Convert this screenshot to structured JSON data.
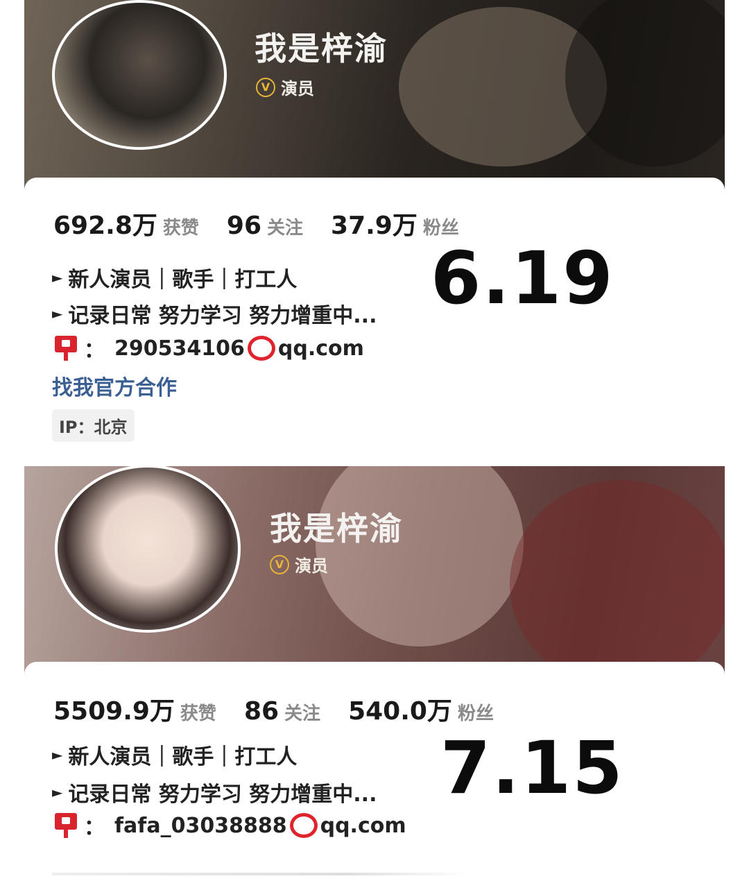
{
  "profiles": [
    {
      "display_name": "我是梓渝",
      "verified_title": "演员",
      "verified_badge": "V",
      "stats": [
        {
          "value": "692.8万",
          "label": "获赞"
        },
        {
          "value": "96",
          "label": "关注"
        },
        {
          "value": "37.9万",
          "label": "粉丝"
        }
      ],
      "bio": [
        "新人演员｜歌手｜打工人",
        "记录日常 努力学习 努力增重中..."
      ],
      "email_colon": "：",
      "email_user": "290534106",
      "email_domain": "qq.com",
      "partner_link": "找我官方合作",
      "ip_location": "IP：北京",
      "overlay_date": "6.19"
    },
    {
      "display_name": "我是梓渝",
      "verified_title": "演员",
      "verified_badge": "V",
      "stats": [
        {
          "value": "5509.9万",
          "label": "获赞"
        },
        {
          "value": "86",
          "label": "关注"
        },
        {
          "value": "540.0万",
          "label": "粉丝"
        }
      ],
      "bio": [
        "新人演员｜歌手｜打工人",
        "记录日常 努力学习 努力增重中..."
      ],
      "email_colon": "：",
      "email_user": "fafa_03038888",
      "email_domain": "qq.com",
      "overlay_date": "7.15"
    }
  ],
  "icons": {
    "verified": "verified-v-badge-icon",
    "email": "mailbox-icon",
    "at_sign": "red-circle-at-icon",
    "bullet": "triangle-bullet-icon"
  },
  "colors": {
    "verified_gold": "#e8b43a",
    "mail_red": "#d9232d",
    "link_blue": "#3a5f93",
    "label_gray": "#8a8a8a"
  }
}
